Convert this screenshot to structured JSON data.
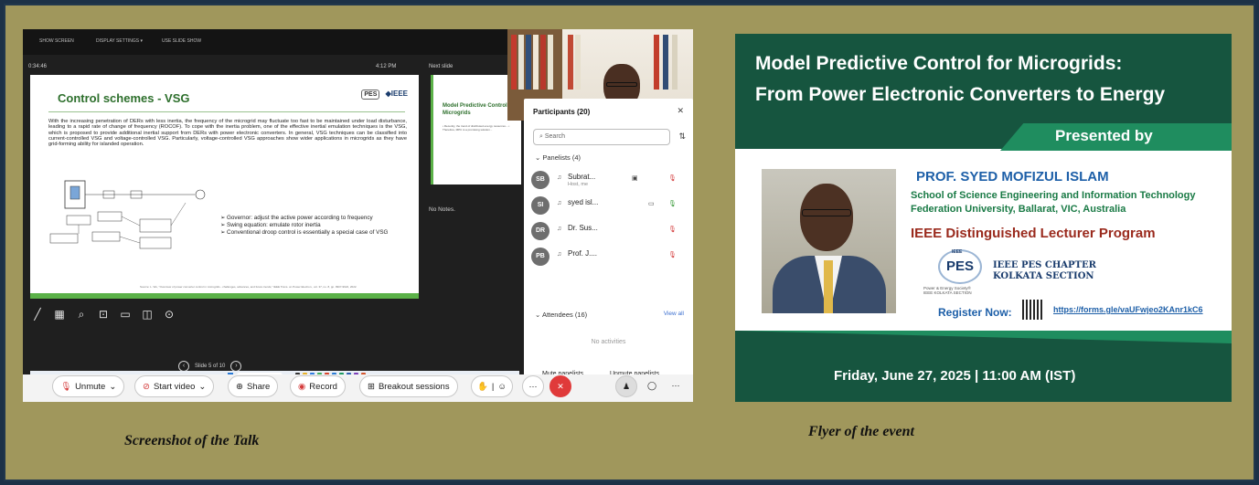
{
  "screenshot": {
    "topbar": [
      "SHOW SCREEN",
      "DISPLAY SETTINGS ▾",
      "USE SLIDE SHOW"
    ],
    "timer": "0:34:46",
    "clock": "4:12 PM",
    "next_slide_label": "Next slide",
    "slide": {
      "title": "Control schemes - VSG",
      "logo_ieee": "◆IEEE",
      "logo_pes": "PES",
      "body": "With the increasing penetration of DERs with less inertia, the frequency of the microgrid may fluctuate too fast to be maintained under load disturbance, leading to a rapid rate of change of frequency (ROCOF). To cope with the inertia problem, one of the effective inertial emulation techniques is the VSG, which is proposed to provide additional inertial support from DERs with power electronic converters. In general, VSG techniques can be classified into current-controlled VSG and voltage-controlled VSG. Particularly, voltage-controlled VSG approaches show wider applications in microgrids as they have grid-forming ability for islanded operation.",
      "bullets": [
        "Governor: adjust the active power according to frequency",
        "Swing equation: emulate rotor inertia",
        "Conventional droop control is essentially a special case of VSG"
      ],
      "source": "Source: L. Wu, \"Overview of power converter control in microgrids - challenges, advances, and future trends,\" IEEE Trans. on Power Electron., vol. 37, no. 8, pp. 9907-9922, 2022."
    },
    "next_slide": {
      "title": "Model Predictive Control for Microgrids",
      "body": "• Recently, the trend of distributed energy resources... • Therefore, MPC is a promising solution..."
    },
    "notes": "No Notes.",
    "slide_nav": "Slide 5 of 10",
    "taskbar_search": "Search",
    "participants": {
      "title": "Participants (20)",
      "search_placeholder": "Search",
      "panelists_label": "Panelists (4)",
      "panelists": [
        {
          "initials": "SB",
          "name": "Subrat...",
          "sub": "Host, me"
        },
        {
          "initials": "SI",
          "name": "syed isl...",
          "sub": ""
        },
        {
          "initials": "DR",
          "name": "Dr. Sus...",
          "sub": ""
        },
        {
          "initials": "PB",
          "name": "Prof. J....",
          "sub": ""
        }
      ],
      "attendees_label": "Attendees (16)",
      "view_all": "View all",
      "no_activities": "No activities",
      "mute_panelists": "Mute panelists",
      "unmute_panelists": "Unmute panelists",
      "more": "..."
    },
    "controls": {
      "unmute": "Unmute",
      "start_video": "Start video",
      "share": "Share",
      "record": "Record",
      "breakout": "Breakout sessions"
    }
  },
  "flyer": {
    "title_line1": "Model Predictive Control for Microgrids:",
    "title_line2": "From Power Electronic Converters to Energy",
    "presented_by": "Presented by",
    "speaker": "PROF. SYED MOFIZUL ISLAM",
    "affiliation_line1": "School of Science Engineering and Information Technology",
    "affiliation_line2": "Federation University, Ballarat, VIC, Australia",
    "program": "IEEE Distinguished Lecturer Program",
    "pes_logo": "PES",
    "pes_logo_small": "IEEE",
    "pes_subtitle": "Power & Energy Society®",
    "pes_section": "IEEE KOLKATA SECTION",
    "chapter_line1": "IEEE PES CHAPTER",
    "chapter_line2": "KOLKATA SECTION",
    "register": "Register Now:",
    "link": "https://forms.gle/vaUFwjeo2KAnr1kC6",
    "date": "Friday, June 27, 2025",
    "time": "11:00 AM (IST)"
  },
  "captions": {
    "left": "Screenshot of the Talk",
    "right": "Flyer of the event"
  }
}
